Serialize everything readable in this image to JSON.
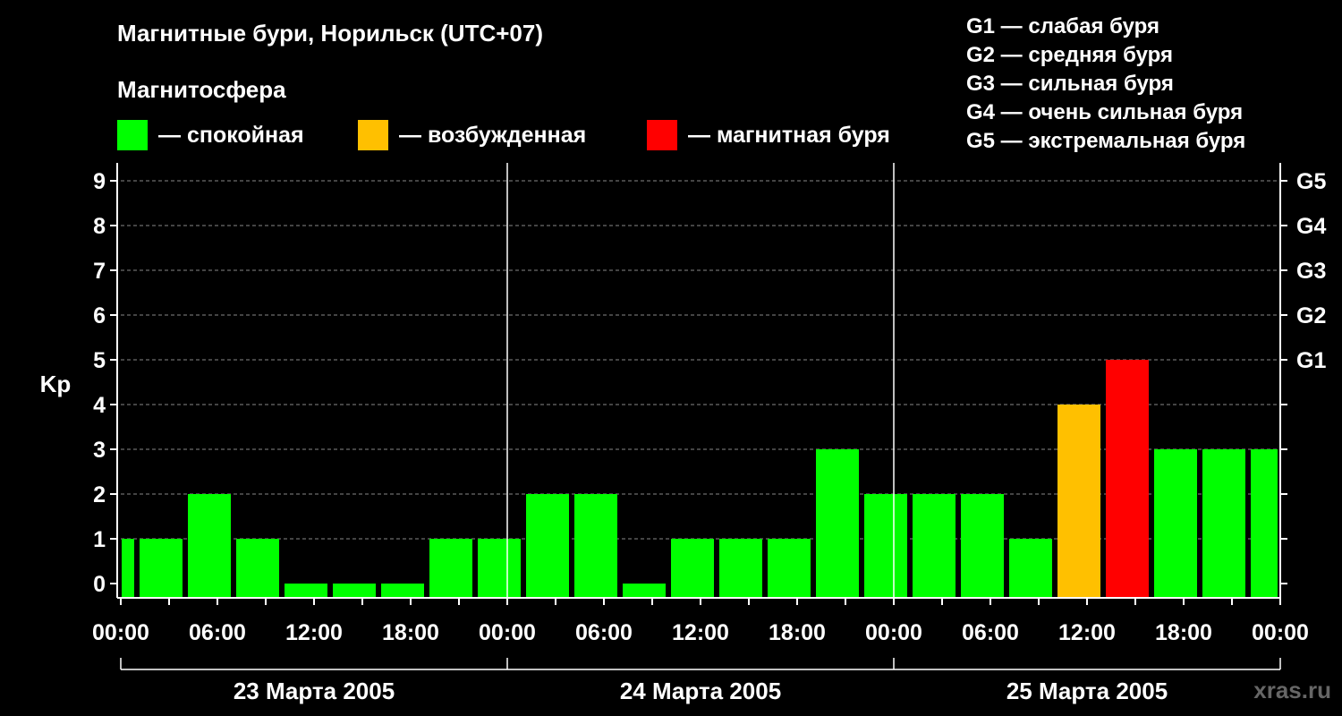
{
  "title": "Магнитные бури, Норильск (UTC+07)",
  "subtitle": "Магнитосфера",
  "legend": [
    {
      "label": "— спокойная",
      "color": "#00ff00"
    },
    {
      "label": "— возбужденная",
      "color": "#ffc000"
    },
    {
      "label": "— магнитная буря",
      "color": "#ff0000"
    }
  ],
  "g_legend": [
    "G1 — слабая буря",
    "G2 — средняя буря",
    "G3 — сильная буря",
    "G4 — очень сильная буря",
    "G5 — экстремальная буря"
  ],
  "watermark": "xras.ru",
  "chart_data": {
    "type": "bar",
    "ylabel": "Kp",
    "ylim": [
      0,
      9
    ],
    "y_ticks": [
      "0",
      "1",
      "2",
      "3",
      "4",
      "5",
      "6",
      "7",
      "8",
      "9"
    ],
    "right_ticks": [
      {
        "value": 5,
        "label": "G1"
      },
      {
        "value": 6,
        "label": "G2"
      },
      {
        "value": 7,
        "label": "G3"
      },
      {
        "value": 8,
        "label": "G4"
      },
      {
        "value": 9,
        "label": "G5"
      }
    ],
    "x_tick_labels": [
      "00:00",
      "06:00",
      "12:00",
      "18:00",
      "00:00",
      "06:00",
      "12:00",
      "18:00",
      "00:00",
      "06:00",
      "12:00",
      "18:00",
      "00:00"
    ],
    "days": [
      "23 Марта 2005",
      "24 Марта 2005",
      "25 Марта 2005"
    ],
    "bars": [
      {
        "start_hour": 0,
        "end_hour": 1,
        "value": 1,
        "level": "quiet"
      },
      {
        "start_hour": 1,
        "end_hour": 4,
        "value": 1,
        "level": "quiet"
      },
      {
        "start_hour": 4,
        "end_hour": 7,
        "value": 2,
        "level": "quiet"
      },
      {
        "start_hour": 7,
        "end_hour": 10,
        "value": 1,
        "level": "quiet"
      },
      {
        "start_hour": 10,
        "end_hour": 13,
        "value": 0,
        "level": "quiet"
      },
      {
        "start_hour": 13,
        "end_hour": 16,
        "value": 0,
        "level": "quiet"
      },
      {
        "start_hour": 16,
        "end_hour": 19,
        "value": 0,
        "level": "quiet"
      },
      {
        "start_hour": 19,
        "end_hour": 22,
        "value": 1,
        "level": "quiet"
      },
      {
        "start_hour": 22,
        "end_hour": 25,
        "value": 1,
        "level": "quiet"
      },
      {
        "start_hour": 25,
        "end_hour": 28,
        "value": 2,
        "level": "quiet"
      },
      {
        "start_hour": 28,
        "end_hour": 31,
        "value": 2,
        "level": "quiet"
      },
      {
        "start_hour": 31,
        "end_hour": 34,
        "value": 0,
        "level": "quiet"
      },
      {
        "start_hour": 34,
        "end_hour": 37,
        "value": 1,
        "level": "quiet"
      },
      {
        "start_hour": 37,
        "end_hour": 40,
        "value": 1,
        "level": "quiet"
      },
      {
        "start_hour": 40,
        "end_hour": 43,
        "value": 1,
        "level": "quiet"
      },
      {
        "start_hour": 43,
        "end_hour": 46,
        "value": 3,
        "level": "quiet"
      },
      {
        "start_hour": 46,
        "end_hour": 49,
        "value": 2,
        "level": "quiet"
      },
      {
        "start_hour": 49,
        "end_hour": 52,
        "value": 2,
        "level": "quiet"
      },
      {
        "start_hour": 52,
        "end_hour": 55,
        "value": 2,
        "level": "quiet"
      },
      {
        "start_hour": 55,
        "end_hour": 58,
        "value": 1,
        "level": "quiet"
      },
      {
        "start_hour": 58,
        "end_hour": 61,
        "value": 4,
        "level": "active"
      },
      {
        "start_hour": 61,
        "end_hour": 64,
        "value": 5,
        "level": "storm"
      },
      {
        "start_hour": 64,
        "end_hour": 67,
        "value": 3,
        "level": "quiet"
      },
      {
        "start_hour": 67,
        "end_hour": 70,
        "value": 3,
        "level": "quiet"
      },
      {
        "start_hour": 70,
        "end_hour": 72,
        "value": 3,
        "level": "quiet"
      }
    ],
    "level_colors": {
      "quiet": "#00ff00",
      "active": "#ffc000",
      "storm": "#ff0000"
    },
    "grid": "dashed horizontal"
  }
}
